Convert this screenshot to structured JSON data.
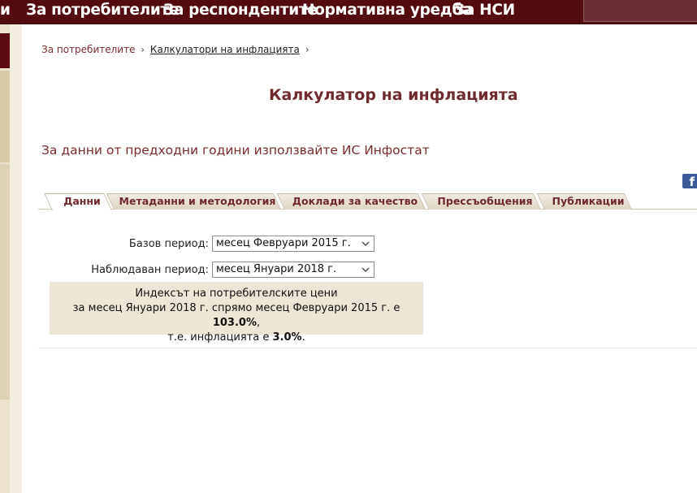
{
  "topnav": {
    "items": [
      {
        "label": "и"
      },
      {
        "label": "За потребителите"
      },
      {
        "label": "За респондентите"
      },
      {
        "label": "Нормативна уредба"
      },
      {
        "label": "За НСИ"
      }
    ]
  },
  "breadcrumb": {
    "parent": "За потребителите",
    "current": "Калкулатори на инфлацията",
    "separator": "›"
  },
  "page_title": "Калкулатор на инфлацията",
  "notice": "За данни от предходни години използвайте ИС Инфостат",
  "social": {
    "facebook_glyph": "f"
  },
  "tabs": [
    {
      "label": "Данни",
      "active": true
    },
    {
      "label": "Метаданни и методология",
      "active": false
    },
    {
      "label": "Доклади за качество",
      "active": false
    },
    {
      "label": "Прессъобщения",
      "active": false
    },
    {
      "label": "Публикации",
      "active": false
    }
  ],
  "form": {
    "base_period_label": "Базов период:",
    "base_period_value": "месец Февруари 2015 г.",
    "observed_period_label": "Наблюдаван период:",
    "observed_period_value": "месец Януари 2018 г."
  },
  "result": {
    "line1": "Индексът на потребителските цени",
    "line2_prefix": "за месец Януари 2018 г. спрямо месец Февруари 2015 г. е ",
    "index_value": "103.0%",
    "line2_suffix": ",",
    "line3_prefix": "т.е. инфлацията е ",
    "inflation_value": "3.0%",
    "line3_suffix": "."
  },
  "colors": {
    "nav_bg": "#530b10",
    "title_color": "#6e2a2e",
    "result_bg": "#ede6d6",
    "facebook_blue": "#3b5998"
  }
}
